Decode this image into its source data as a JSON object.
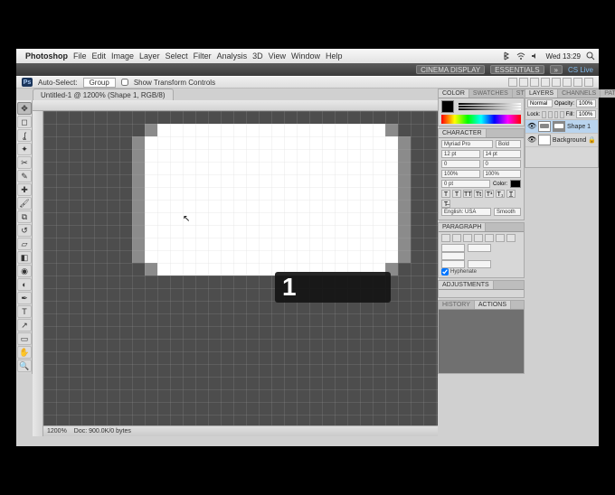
{
  "os": {
    "apple_glyph": "",
    "app_name": "Photoshop",
    "menu": [
      "File",
      "Edit",
      "Image",
      "Layer",
      "Select",
      "Filter",
      "Analysis",
      "3D",
      "View",
      "Window",
      "Help"
    ],
    "clock": "Wed 13:29",
    "search_icon": "search-icon"
  },
  "app_bar": {
    "workspace_a": "CINEMA DISPLAY",
    "workspace_b": "ESSENTIALS",
    "cs_live": "CS Live"
  },
  "options_bar": {
    "ps_badge": "Ps",
    "auto_select": "Auto-Select:",
    "dropdown": "Group",
    "show_transform": "Show Transform Controls"
  },
  "doc_tab": "Untitled-1 @ 1200% (Shape 1, RGB/8)",
  "status": {
    "zoom": "1200%",
    "info": "Doc: 900.0K/0 bytes"
  },
  "overlay_number": "1",
  "panels": {
    "color": {
      "tab_color": "COLOR",
      "tab_swatches": "SWATCHES",
      "tab_styles": "STYLES",
      "fg": "#000000",
      "bg": "#ffffff"
    },
    "character": {
      "tab": "CHARACTER",
      "font": "Myriad Pro",
      "style": "Bold",
      "size": "12 pt",
      "leading": "14 pt",
      "kerning": "0",
      "tracking": "0",
      "vscale": "100%",
      "hscale": "100%",
      "baseline": "0 pt",
      "color_label": "Color:",
      "lang": "English: USA",
      "aa": "Smooth"
    },
    "paragraph": {
      "tab": "PARAGRAPH",
      "hyphenate": "Hyphenate"
    },
    "adjustments": {
      "tab": "ADJUSTMENTS"
    },
    "history": {
      "tab_history": "HISTORY",
      "tab_actions": "ACTIONS"
    },
    "layers": {
      "tab_layers": "LAYERS",
      "tab_channels": "CHANNELS",
      "tab_paths": "PATHS",
      "mode": "Normal",
      "opacity_label": "Opacity:",
      "opacity": "100%",
      "lock_label": "Lock:",
      "fill_label": "Fill:",
      "fill": "100%",
      "items": [
        {
          "name": "Shape 1",
          "selected": true
        },
        {
          "name": "Background",
          "selected": false
        }
      ]
    }
  }
}
